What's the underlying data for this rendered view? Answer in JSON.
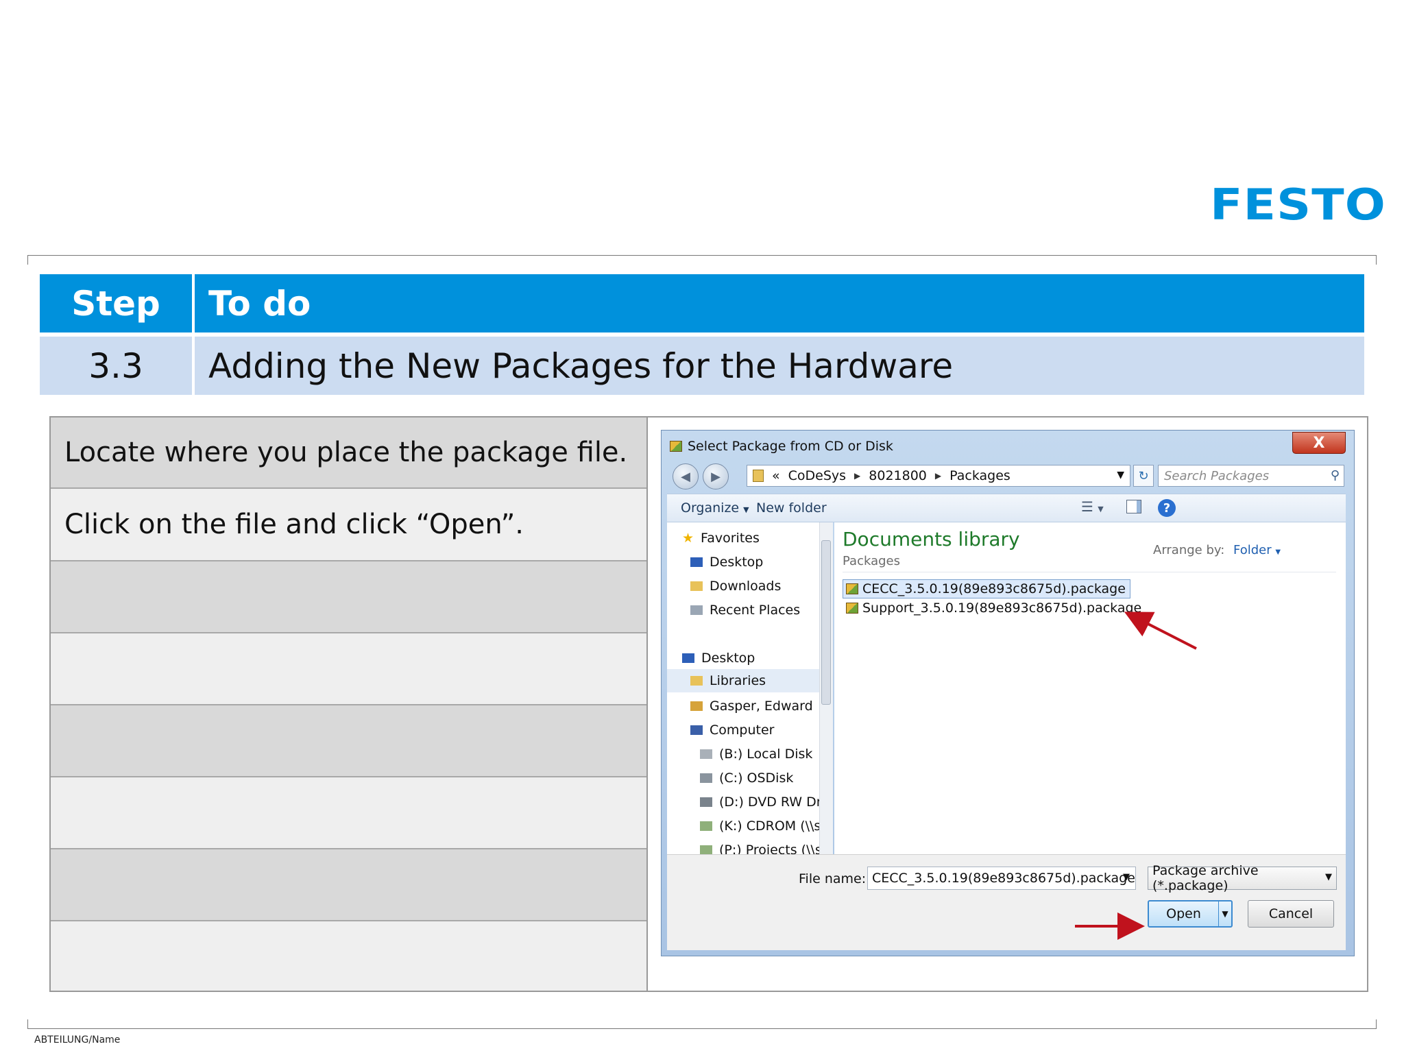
{
  "brand": {
    "logo_text": "FESTO",
    "color": "#0091dc"
  },
  "header": {
    "step_label": "Step",
    "todo_label": "To do",
    "step_number": "3.3",
    "step_title": "Adding the New Packages for the Hardware",
    "header_color": "#0091dc",
    "row_color": "#ccdcf1"
  },
  "instructions": [
    "Locate where you place the package file.",
    "Click on the file and click “Open”.",
    "",
    "",
    "",
    "",
    "",
    ""
  ],
  "dialog": {
    "title": "Select Package from CD or Disk",
    "close_label": "X",
    "breadcrumb": {
      "prefix": "«",
      "items": [
        "CoDeSys",
        "8021800",
        "Packages"
      ]
    },
    "search_placeholder": "Search Packages",
    "toolbar": {
      "organize": "Organize",
      "new_folder": "New folder",
      "help": "?"
    },
    "nav": {
      "favorites": "Favorites",
      "fav_items": [
        "Desktop",
        "Downloads",
        "Recent Places"
      ],
      "desktop": "Desktop",
      "libraries": "Libraries",
      "user": "Gasper, Edward",
      "computer": "Computer",
      "drives": [
        "(B:) Local Disk",
        "(C:) OSDisk",
        "(D:) DVD RW Dr",
        "(K:) CDROM (\\\\s",
        "(P:) Projects (\\\\s"
      ]
    },
    "library": {
      "title": "Documents library",
      "subtitle": "Packages",
      "arrange_label": "Arrange by:",
      "arrange_value": "Folder"
    },
    "files": [
      {
        "name": "CECC_3.5.0.19(89e893c8675d).package",
        "selected": true
      },
      {
        "name": "Support_3.5.0.19(89e893c8675d).package",
        "selected": false
      }
    ],
    "file_name_label": "File name:",
    "file_name_value": "CECC_3.5.0.19(89e893c8675d).package",
    "file_type_value": "Package archive (*.package)",
    "open_label": "Open",
    "cancel_label": "Cancel"
  },
  "footer": {
    "text": "ABTEILUNG/Name"
  }
}
